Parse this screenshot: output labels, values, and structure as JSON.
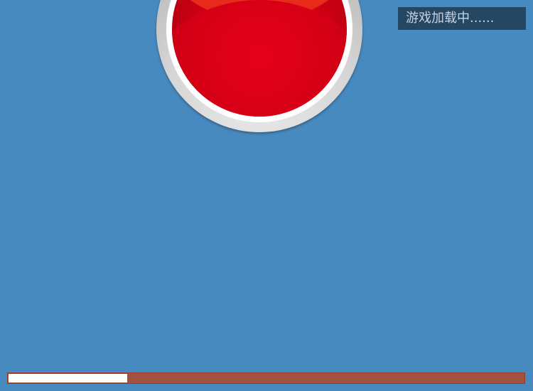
{
  "game": {
    "loading_text": "游戏加载中......",
    "progress": 0.23
  },
  "colors": {
    "background": "#478ac0",
    "button_red": "#e6001a",
    "label_bg": "#244764",
    "progress_track": "#a2513c",
    "progress_fill": "#ffffff"
  },
  "icons": {
    "start_button": "red-round-button-icon"
  }
}
